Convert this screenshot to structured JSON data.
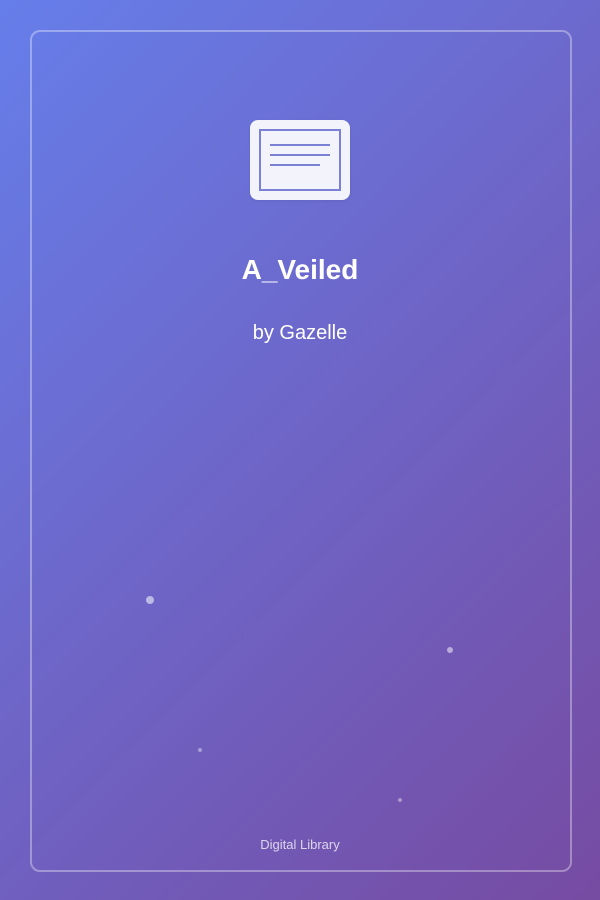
{
  "cover": {
    "title": "A_Veiled",
    "author": "by Gazelle",
    "footer": "Digital Library",
    "icon": "book-page-icon",
    "colors": {
      "gradient_start": "#667eea",
      "gradient_end": "#764ba2",
      "icon_background": "#f3f4fb",
      "icon_stroke": "#7b82d6",
      "text": "#ffffff"
    }
  }
}
